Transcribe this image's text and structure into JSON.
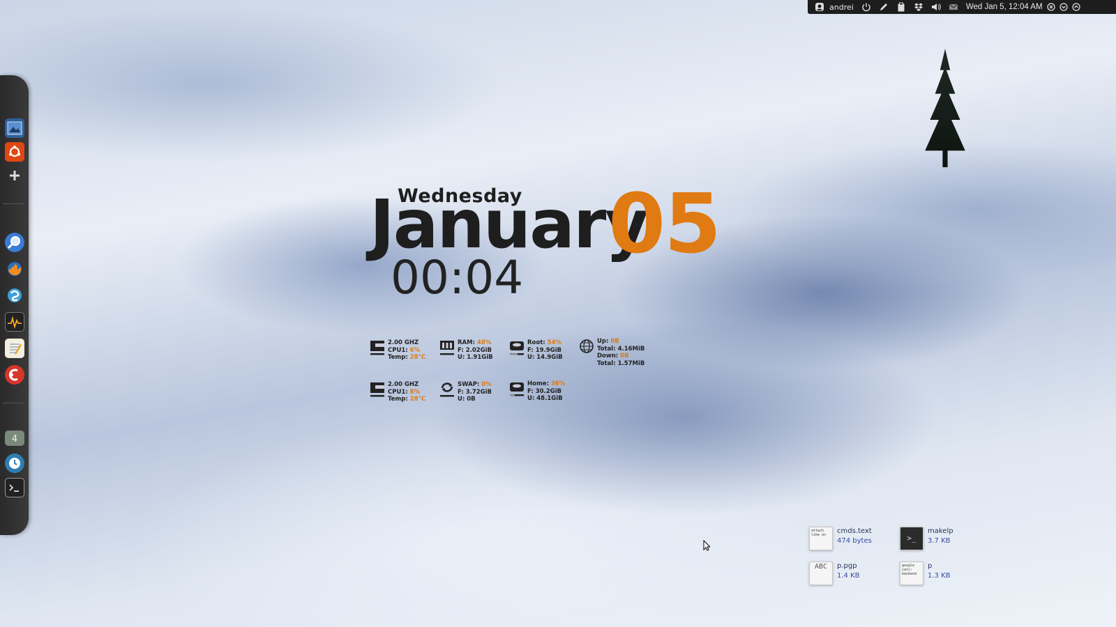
{
  "top_panel": {
    "user": "andrei",
    "clock": "Wed Jan 5, 12:04 AM",
    "icons": [
      "user-icon",
      "power-icon",
      "pen-icon",
      "clipboard-icon",
      "dropbox-icon",
      "volume-icon",
      "mail-icon",
      "close-circle-icon",
      "chevron-circle-icon",
      "up-circle-icon"
    ]
  },
  "dock": {
    "items": [
      "workspace-switcher",
      "ubuntu-software",
      "add",
      "search-app",
      "firefox",
      "skype",
      "system-monitor",
      "text-editor",
      "dock-app",
      "workspace-4",
      "clock-app",
      "terminal"
    ]
  },
  "clock_widget": {
    "day": "Wednesday",
    "month": "January",
    "date": "05",
    "time": "00:04"
  },
  "system_monitor": {
    "cpu": [
      {
        "freq": "2.00 GHZ",
        "cpu_label": "CPU1:",
        "cpu_value": "6%",
        "temp_label": "Temp:",
        "temp_value": "28°C"
      },
      {
        "freq": "2.00 GHZ",
        "cpu_label": "CPU1:",
        "cpu_value": "8%",
        "temp_label": "Temp:",
        "temp_value": "28°C"
      }
    ],
    "ram": {
      "label": "RAM:",
      "value": "48%",
      "free": "F: 2.02GiB",
      "used": "U: 1.91GiB"
    },
    "swap": {
      "label": "SWAP:",
      "value": "0%",
      "free": "F: 3.72GiB",
      "used": "U: 0B"
    },
    "root": {
      "label": "Root:",
      "value": "54%",
      "free": "F: 19.9GiB",
      "used": "U: 14.9GiB"
    },
    "home": {
      "label": "Home:",
      "value": "36%",
      "free": "F: 30.2GiB",
      "used": "U: 48.1GiB"
    },
    "net": {
      "up_label": "Up:",
      "up_value": "0B",
      "up_total": "Total: 4.16MiB",
      "down_label": "Down:",
      "down_value": "0B",
      "down_total": "Total: 1.57MiB"
    }
  },
  "desktop_files": [
    {
      "name": "cmds.text",
      "size": "474 bytes",
      "preview": "attach\nlike on"
    },
    {
      "name": "makelp",
      "size": "3.7 KB",
      "preview": ">_"
    },
    {
      "name": "p.pgp",
      "size": "1.4 KB",
      "preview": "ABC"
    },
    {
      "name": "p",
      "size": "1.3 KB",
      "preview": "google\ncalc:\nbackend"
    }
  ]
}
